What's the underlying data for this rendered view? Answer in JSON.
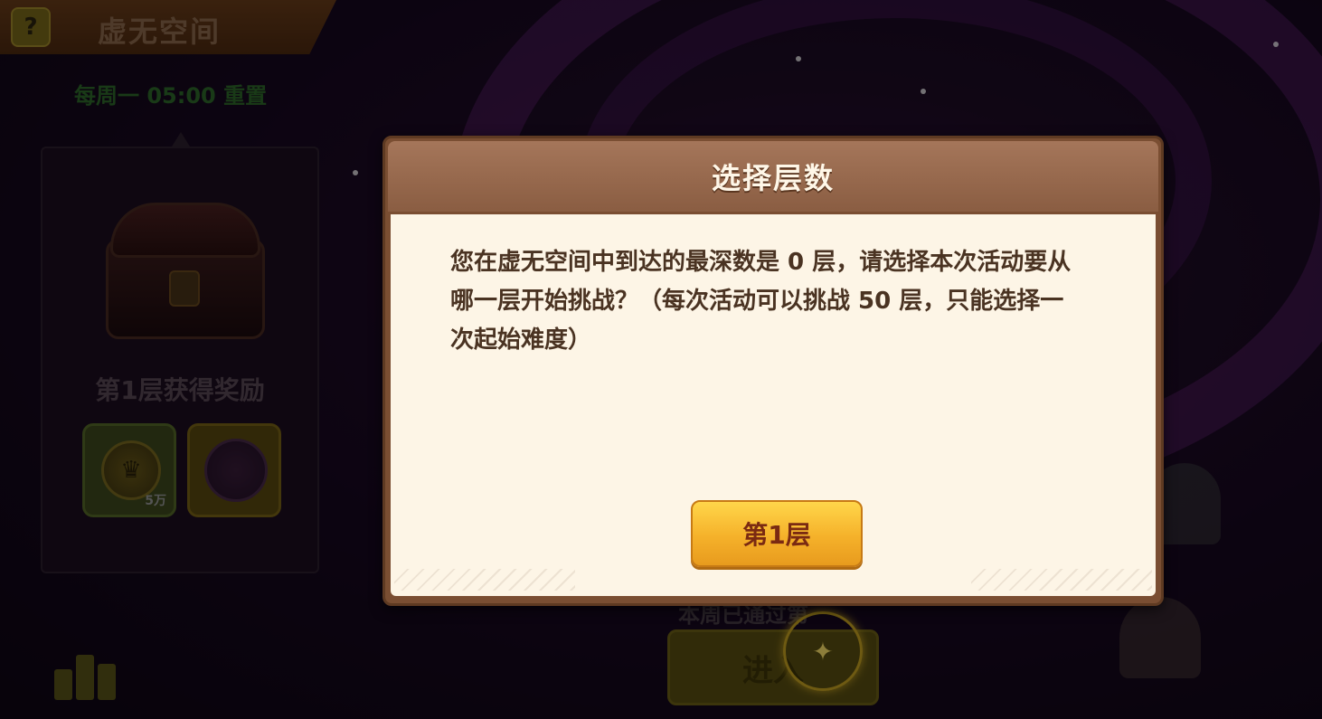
{
  "screen": {
    "title": "虚无空间",
    "help_icon": "?",
    "reset_text": "每周一 05:00 重置"
  },
  "reward_panel": {
    "label": "第1层获得奖励",
    "items": [
      {
        "icon": "gold-coin-icon",
        "count": "5万"
      },
      {
        "icon": "hero-token-icon",
        "count": ""
      }
    ]
  },
  "bottom": {
    "enter_label": "进入",
    "behind_text": "本周已通过第"
  },
  "dialog": {
    "title": "选择层数",
    "message": "您在虚无空间中到达的最深数是 0 层，请选择本次活动要从哪一层开始挑战？（每次活动可以挑战 50 层，只能选择一次起始难度）",
    "option_label": "第1层"
  },
  "colors": {
    "dialog_header": "#8a5d42",
    "dialog_body": "#fdf5e6",
    "button_gold": "#f5b12a",
    "button_text": "#7a2a12"
  }
}
